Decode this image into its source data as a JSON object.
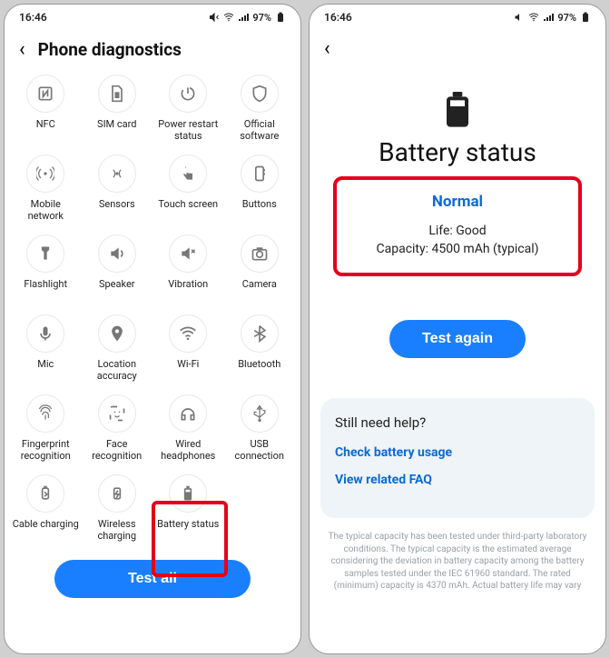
{
  "status_bar": {
    "time": "16:46",
    "battery_pct": "97%"
  },
  "left": {
    "title": "Phone diagnostics",
    "tiles": [
      {
        "label": "NFC",
        "icon": "nfc"
      },
      {
        "label": "SIM card",
        "icon": "sim"
      },
      {
        "label": "Power restart status",
        "icon": "power"
      },
      {
        "label": "Official software",
        "icon": "shield"
      },
      {
        "label": "Mobile network",
        "icon": "antenna"
      },
      {
        "label": "Sensors",
        "icon": "sensors"
      },
      {
        "label": "Touch screen",
        "icon": "touch"
      },
      {
        "label": "Buttons",
        "icon": "buttons"
      },
      {
        "label": "Flashlight",
        "icon": "flashlight"
      },
      {
        "label": "Speaker",
        "icon": "speaker"
      },
      {
        "label": "Vibration",
        "icon": "vibration"
      },
      {
        "label": "Camera",
        "icon": "camera"
      },
      {
        "label": "Mic",
        "icon": "mic"
      },
      {
        "label": "Location accuracy",
        "icon": "location"
      },
      {
        "label": "Wi-Fi",
        "icon": "wifi"
      },
      {
        "label": "Bluetooth",
        "icon": "bluetooth"
      },
      {
        "label": "Fingerprint recognition",
        "icon": "fingerprint"
      },
      {
        "label": "Face recognition",
        "icon": "face"
      },
      {
        "label": "Wired headphones",
        "icon": "headphones"
      },
      {
        "label": "USB connection",
        "icon": "usb"
      },
      {
        "label": "Cable charging",
        "icon": "cable"
      },
      {
        "label": "Wireless charging",
        "icon": "wireless"
      },
      {
        "label": "Battery status",
        "icon": "battery"
      }
    ],
    "test_all": "Test all"
  },
  "right": {
    "title": "Battery status",
    "status": "Normal",
    "life_label": "Life: Good",
    "capacity_label": "Capacity: 4500 mAh (typical)",
    "test_again": "Test again",
    "help_title": "Still need help?",
    "help_links": [
      "Check battery usage",
      "View related FAQ"
    ],
    "fine_print": "The typical capacity has been tested under third-party laboratory conditions. The typical capacity is the estimated average considering the deviation in battery capacity among the battery samples tested under the IEC 61960 standard. The rated (minimum) capacity is 4370 mAh. Actual battery life may vary"
  }
}
